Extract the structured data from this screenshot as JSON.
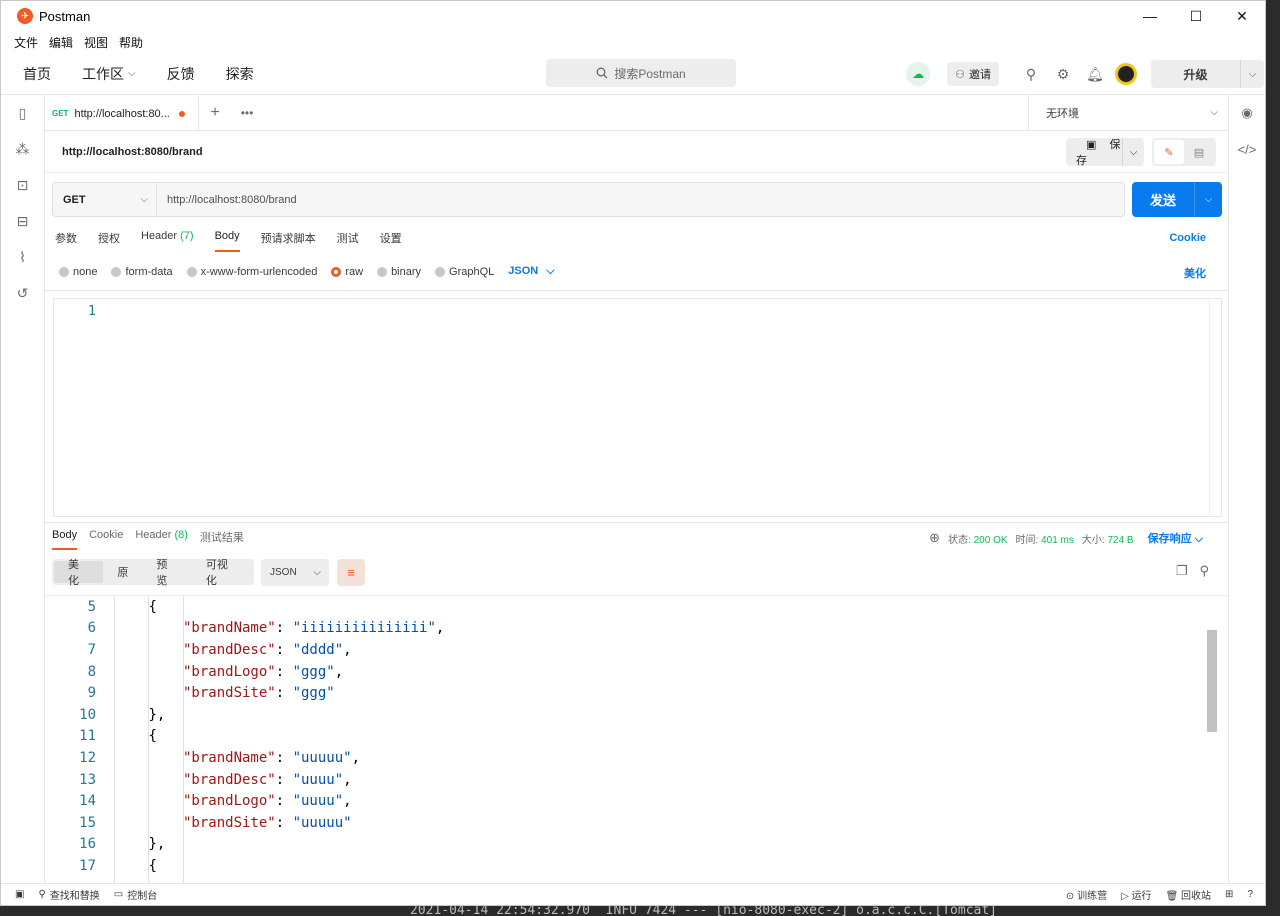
{
  "app": {
    "title": "Postman",
    "logo_glyph": "✈"
  },
  "window_controls": {
    "minimize": "—",
    "maximize": "☐",
    "close": "✕"
  },
  "menu": [
    "文件",
    "编辑",
    "视图",
    "帮助"
  ],
  "nav": {
    "home": "首页",
    "workspace": "工作区",
    "feedback": "反馈",
    "explore": "探索"
  },
  "search": {
    "placeholder": "搜索Postman"
  },
  "toolbar": {
    "invite": "邀请",
    "upgrade": "升级"
  },
  "tab": {
    "method": "GET",
    "label": "http://localhost:80..."
  },
  "environment": {
    "selected": "无环境"
  },
  "request": {
    "name": "http://localhost:8080/brand",
    "save": "保存",
    "method": "GET",
    "url": "http://localhost:8080/brand",
    "send": "发送",
    "tabs": {
      "params": "参数",
      "auth": "授权",
      "headers": "Header",
      "headers_count": "(7)",
      "body": "Body",
      "prerequest": "预请求脚本",
      "tests": "测试",
      "settings": "设置"
    },
    "cookie": "Cookie",
    "body_types": {
      "none": "none",
      "form_data": "form-data",
      "urlencoded": "x-www-form-urlencoded",
      "raw": "raw",
      "binary": "binary",
      "graphql": "GraphQL",
      "format": "JSON"
    },
    "beautify": "美化",
    "editor_line": "1"
  },
  "response": {
    "tabs": {
      "body": "Body",
      "cookie": "Cookie",
      "headers": "Header",
      "headers_count": "(8)",
      "tests": "测试结果"
    },
    "status_label": "状态:",
    "status": "200 OK",
    "time_label": "时间:",
    "time": "401 ms",
    "size_label": "大小:",
    "size": "724 B",
    "save": "保存响应",
    "views": {
      "pretty": "美化",
      "raw": "原",
      "preview": "预览",
      "visualize": "可视化"
    },
    "format": "JSON",
    "lines": [
      {
        "n": "5",
        "indent": 3,
        "text": "{"
      },
      {
        "n": "6",
        "indent": 4,
        "key": "brandName",
        "val": "iiiiiiiiiiiiiii",
        "comma": ","
      },
      {
        "n": "7",
        "indent": 4,
        "key": "brandDesc",
        "val": "dddd",
        "comma": ","
      },
      {
        "n": "8",
        "indent": 4,
        "key": "brandLogo",
        "val": "ggg",
        "comma": ","
      },
      {
        "n": "9",
        "indent": 4,
        "key": "brandSite",
        "val": "ggg",
        "comma": ""
      },
      {
        "n": "10",
        "indent": 3,
        "text": "},"
      },
      {
        "n": "11",
        "indent": 3,
        "text": "{"
      },
      {
        "n": "12",
        "indent": 4,
        "key": "brandName",
        "val": "uuuuu",
        "comma": ","
      },
      {
        "n": "13",
        "indent": 4,
        "key": "brandDesc",
        "val": "uuuu",
        "comma": ","
      },
      {
        "n": "14",
        "indent": 4,
        "key": "brandLogo",
        "val": "uuuu",
        "comma": ","
      },
      {
        "n": "15",
        "indent": 4,
        "key": "brandSite",
        "val": "uuuuu",
        "comma": ""
      },
      {
        "n": "16",
        "indent": 3,
        "text": "},"
      },
      {
        "n": "17",
        "indent": 3,
        "text": "{"
      }
    ]
  },
  "statusbar": {
    "find_replace": "查找和替换",
    "console": "控制台",
    "trainer": "训练营",
    "runner": "运行",
    "trash": "回收站"
  },
  "terminal_text": "2021-04-14 22:54:32.970  INFO 7424 --- [nio-8080-exec-2] o.a.c.c.C.[Tomcat]"
}
